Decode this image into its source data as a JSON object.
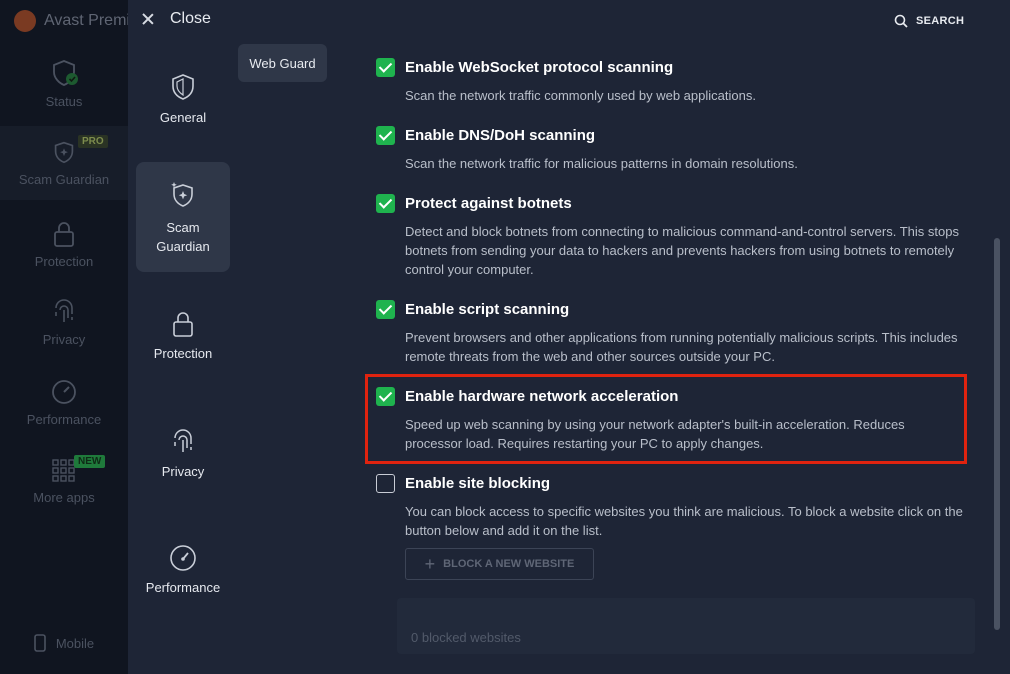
{
  "background_app": {
    "title": "Avast Premi",
    "nav": [
      {
        "label": "Status",
        "icon": "shield-check-icon"
      },
      {
        "label": "Scam Guardian",
        "icon": "sparkle-shield-icon",
        "badge": "PRO"
      },
      {
        "label": "Protection",
        "icon": "lock-icon"
      },
      {
        "label": "Privacy",
        "icon": "fingerprint-icon"
      },
      {
        "label": "Performance",
        "icon": "gauge-icon"
      },
      {
        "label": "More apps",
        "icon": "grid-icon",
        "badge": "NEW"
      },
      {
        "label": "Mobile",
        "icon": "phone-icon"
      }
    ]
  },
  "dialog": {
    "close_label": "Close",
    "search_label": "SEARCH",
    "categories": [
      {
        "label": "General",
        "icon": "shield-icon"
      },
      {
        "label": "Scam\nGuardian",
        "icon": "sparkle-shield-icon",
        "active": true
      },
      {
        "label": "Protection",
        "icon": "lock-icon"
      },
      {
        "label": "Privacy",
        "icon": "fingerprint-icon"
      },
      {
        "label": "Performance",
        "icon": "gauge-icon"
      }
    ],
    "sub_tab": "Web Guard",
    "settings": [
      {
        "title": "Enable WebSocket protocol scanning",
        "desc": "Scan the network traffic commonly used by web applications.",
        "checked": true
      },
      {
        "title": "Enable DNS/DoH scanning",
        "desc": "Scan the network traffic for malicious patterns in domain resolutions.",
        "checked": true
      },
      {
        "title": "Protect against botnets",
        "desc": "Detect and block botnets from connecting to malicious command-and-control servers. This stops botnets from sending your data to hackers and prevents hackers from using botnets to remotely control your computer.",
        "checked": true
      },
      {
        "title": "Enable script scanning",
        "desc": "Prevent browsers and other applications from running potentially malicious scripts. This includes remote threats from the web and other sources outside your PC.",
        "checked": true
      },
      {
        "title": "Enable hardware network acceleration",
        "desc": "Speed up web scanning by using your network adapter's built-in acceleration. Reduces processor load. Requires restarting your PC to apply changes.",
        "checked": true
      },
      {
        "title": "Enable site blocking",
        "desc": "You can block access to specific websites you think are malicious. To block a website click on the button below and add it on the list.",
        "checked": false
      }
    ],
    "block_button_label": "BLOCK A NEW WEBSITE",
    "blocked_count_text": "0 blocked websites"
  },
  "colors": {
    "accent_green": "#1fb34e",
    "highlight_red": "#e0230f",
    "dialog_bg": "#1e2536"
  }
}
